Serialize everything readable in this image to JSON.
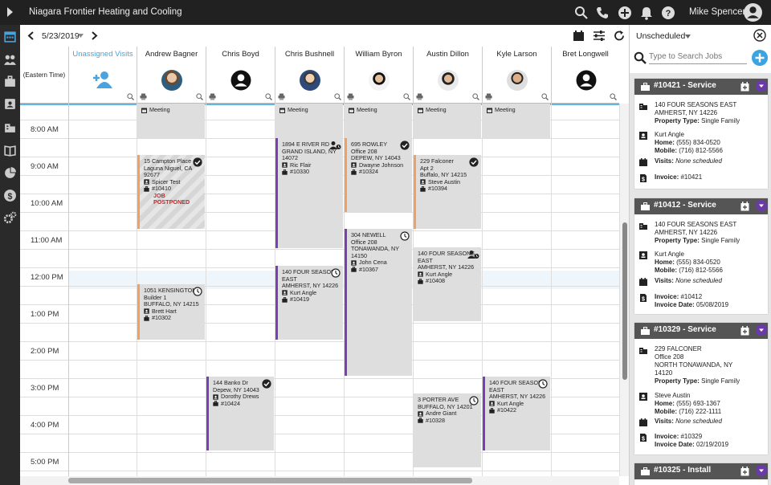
{
  "app": {
    "title": "Niagara Frontier Heating and Cooling",
    "user": "Mike Spencer"
  },
  "toolbar": {
    "date": "5/23/2019"
  },
  "grid": {
    "timezone": "(Eastern Time)",
    "columns": [
      {
        "name": "Unassigned Visits"
      },
      {
        "name": "Andrew Bagner"
      },
      {
        "name": "Chris Boyd"
      },
      {
        "name": "Chris Bushnell"
      },
      {
        "name": "William Byron"
      },
      {
        "name": "Austin Dillon"
      },
      {
        "name": "Kyle Larson"
      },
      {
        "name": "Bret Longwell"
      }
    ],
    "times": [
      "8:00 AM",
      "9:00 AM",
      "10:00 AM",
      "11:00 AM",
      "12:00 PM",
      "1:00 PM",
      "2:00 PM",
      "3:00 PM",
      "4:00 PM",
      "5:00 PM"
    ],
    "meeting_label": "Meeting",
    "events": [
      {
        "addr": "15 Campton Place\nLaguna Niguel, CA\n92677",
        "who": "Spicer Test",
        "job": "#10410",
        "status": "JOB POSTPONED"
      },
      {
        "addr": "1051 KENSINGTON\nBuilder 1\nBUFFALO, NY 14215",
        "who": "Brett Hart",
        "job": "#10302"
      },
      {
        "addr": "144 Banko Dr\nDepew, NY 14043",
        "who": "Dorothy Drews",
        "job": "#10424"
      },
      {
        "addr": "1894 E RIVER RD\nGRAND ISLAND, NY\n14072",
        "who": "Ric Flair",
        "job": "#10330"
      },
      {
        "addr": "140 FOUR SEASONS\nEAST\nAMHERST, NY 14226",
        "who": "Kurt Angle",
        "job": "#10419"
      },
      {
        "addr": "695 ROWLEY\nOffice 208\nDEPEW, NY 14043",
        "who": "Dwayne Johnson",
        "job": "#10324"
      },
      {
        "addr": "304 NEWELL\nOffice 208\nTONAWANDA, NY\n14150",
        "who": "John Cena",
        "job": "#10367"
      },
      {
        "addr": "229 Falconer\nApt 2\nBuffalo, NY 14215",
        "who": "Steve Austin",
        "job": "#10394"
      },
      {
        "addr": "140 FOUR SEASONS\nEAST\nAMHERST, NY 14226",
        "who": "Kurt Angle",
        "job": "#10408"
      },
      {
        "addr": "3 PORTER AVE\nBUFFALO, NY 14201",
        "who": "Andre Giant",
        "job": "#10328"
      },
      {
        "addr": "140 FOUR SEASONS\nEAST\nAMHERST, NY 14226",
        "who": "Kurt Angle",
        "job": "#10422"
      }
    ]
  },
  "panel": {
    "filter": "Unscheduled",
    "search_placeholder": "Type to Search Jobs",
    "labels": {
      "property_type": "Property Type:",
      "home": "Home:",
      "mobile": "Mobile:",
      "visits": "Visits:",
      "invoice": "Invoice:",
      "invoice_date": "Invoice Date:"
    },
    "cards": [
      {
        "title": "#10421 - Service",
        "addr": "140 FOUR SEASONS EAST\nAMHERST, NY 14226",
        "ptype": "Single Family",
        "contact": "Kurt Angle",
        "home": "(555) 834-0520",
        "mobile": "(716) 812-5566",
        "visits": "None scheduled",
        "invoice": "#10421",
        "invoice_date": ""
      },
      {
        "title": "#10412 - Service",
        "addr": "140 FOUR SEASONS EAST\nAMHERST, NY 14226",
        "ptype": "Single Family",
        "contact": "Kurt Angle",
        "home": "(555) 834-0520",
        "mobile": "(716) 812-5566",
        "visits": "None scheduled",
        "invoice": "#10412",
        "invoice_date": "05/08/2019"
      },
      {
        "title": "#10329 - Service",
        "addr": "229 FALCONER\nOffice 208\nNORTH TONAWANDA, NY\n14120",
        "ptype": "Single Family",
        "contact": "Steve Austin",
        "home": "(555) 693-1367",
        "mobile": "(716) 222-1111",
        "visits": "None scheduled",
        "invoice": "#10329",
        "invoice_date": "02/19/2019"
      },
      {
        "title": "#10325 - Install"
      }
    ]
  }
}
